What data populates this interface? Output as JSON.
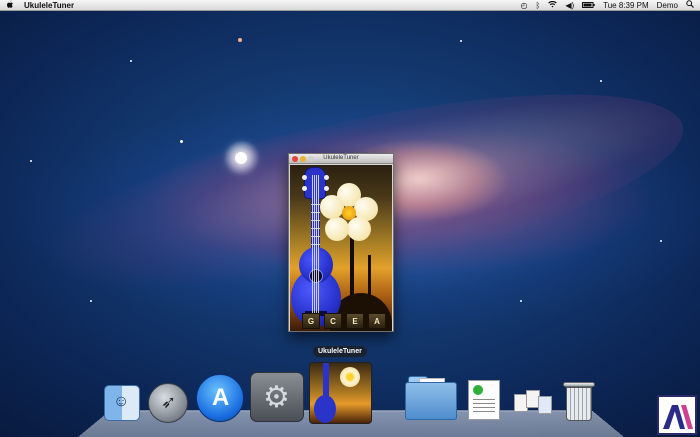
{
  "menubar": {
    "apple_icon": "",
    "app_name": "UkuleleTuner",
    "status": {
      "time_machine_icon": "time-machine-icon",
      "bluetooth_icon": "bluetooth-icon",
      "wifi_icon": "wifi-icon",
      "volume_icon": "volume-icon",
      "battery_icon": "battery-icon",
      "clock": "Tue 8:39 PM",
      "user": "Demo",
      "spotlight_icon": "spotlight-search-icon"
    }
  },
  "window": {
    "title": "UkuleleTuner",
    "notes": [
      "G",
      "C",
      "E",
      "A"
    ]
  },
  "dock": {
    "tooltip": "UkuleleTuner",
    "items": [
      "Finder",
      "Launchpad",
      "App Store",
      "System Preferences",
      "UkuleleTuner",
      "Applications",
      "Documents",
      "Downloads",
      "Trash"
    ]
  },
  "colors": {
    "ukulele": "#2a34c8",
    "menubar": "#e8e8e8",
    "wallpaper": "#0c2656"
  }
}
